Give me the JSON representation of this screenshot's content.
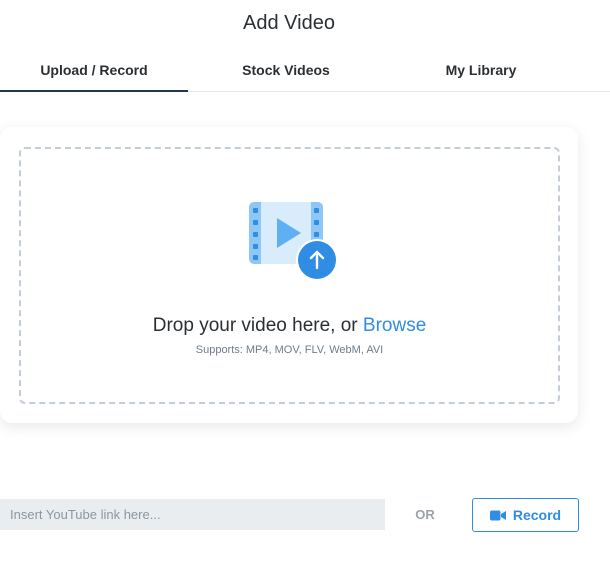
{
  "modal": {
    "title": "Add Video"
  },
  "tabs": [
    {
      "label": "Upload / Record",
      "active": true
    },
    {
      "label": "Stock Videos",
      "active": false
    },
    {
      "label": "My Library",
      "active": false
    }
  ],
  "dropzone": {
    "icon": "video-upload-icon",
    "prompt": "Drop your video here, or ",
    "browse_label": "Browse",
    "supports": "Supports: MP4, MOV, FLV, WebM, AVI"
  },
  "youtube": {
    "placeholder": "Insert YouTube link here...",
    "value": ""
  },
  "or_label": "OR",
  "record": {
    "icon": "video-camera-icon",
    "label": "Record"
  },
  "colors": {
    "accent": "#2f8de4",
    "text": "#2b2f33",
    "active_tab_underline": "#24364d"
  }
}
